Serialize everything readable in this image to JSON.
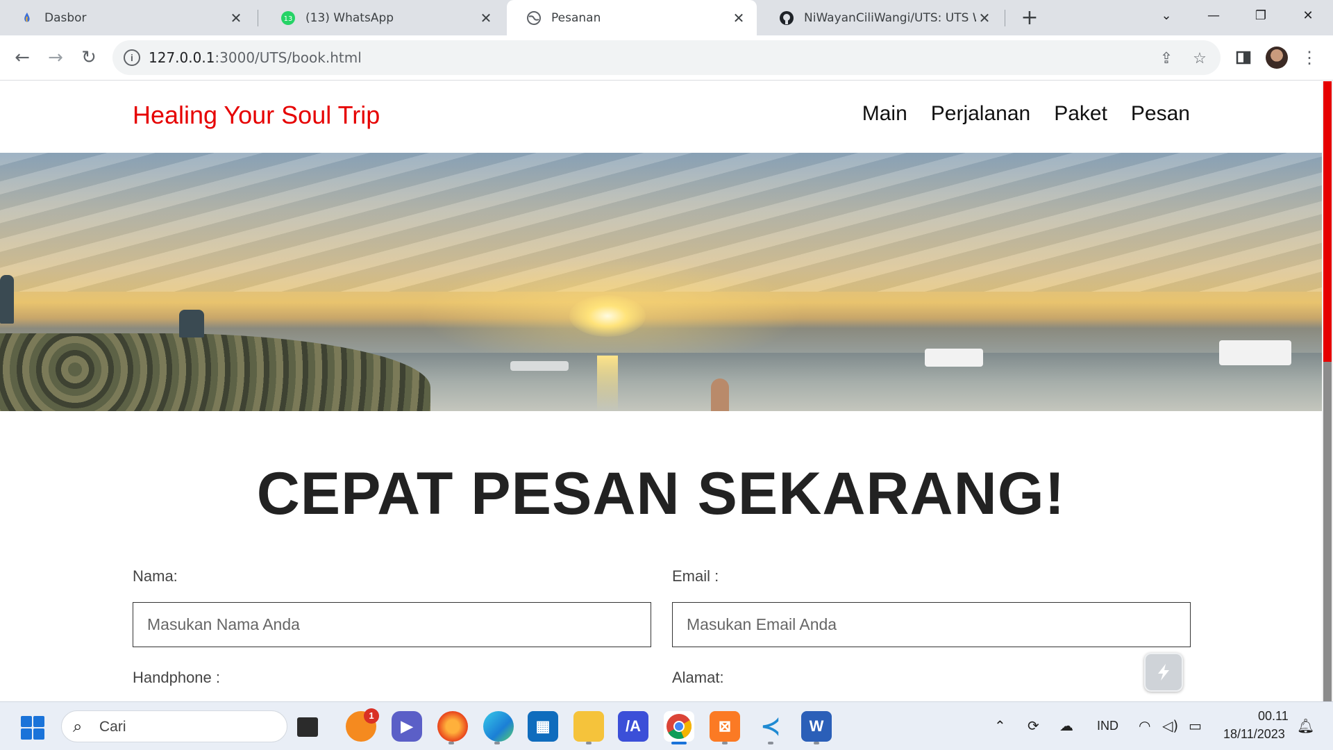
{
  "browser": {
    "tabs": [
      {
        "title": "Dasbor",
        "icon": "wordpress-icon"
      },
      {
        "title": "(13) WhatsApp",
        "icon": "whatsapp-icon",
        "badge": "13"
      },
      {
        "title": "Pesanan",
        "icon": "globe-icon",
        "active": true
      },
      {
        "title": "NiWayanCiliWangi/UTS: UTS Web",
        "icon": "github-icon"
      }
    ],
    "url_host": "127.0.0.1",
    "url_rest": ":3000/UTS/book.html"
  },
  "site": {
    "brand": "Healing Your Soul Trip",
    "nav": [
      "Main",
      "Perjalanan",
      "Paket",
      "Pesan"
    ],
    "heading": "CEPAT PESAN SEKARANG!",
    "form": {
      "name_label": "Nama:",
      "name_placeholder": "Masukan Nama Anda",
      "email_label": "Email :",
      "email_placeholder": "Masukan Email Anda",
      "phone_label": "Handphone :",
      "address_label": "Alamat:"
    }
  },
  "taskbar": {
    "search_placeholder": "Cari",
    "notification_badge": "1",
    "language": "IND",
    "time": "00.11",
    "date": "18/11/2023"
  },
  "colors": {
    "brand": "#e60000",
    "tab_strip": "#dee1e6",
    "taskbar": "#e9eef6"
  }
}
